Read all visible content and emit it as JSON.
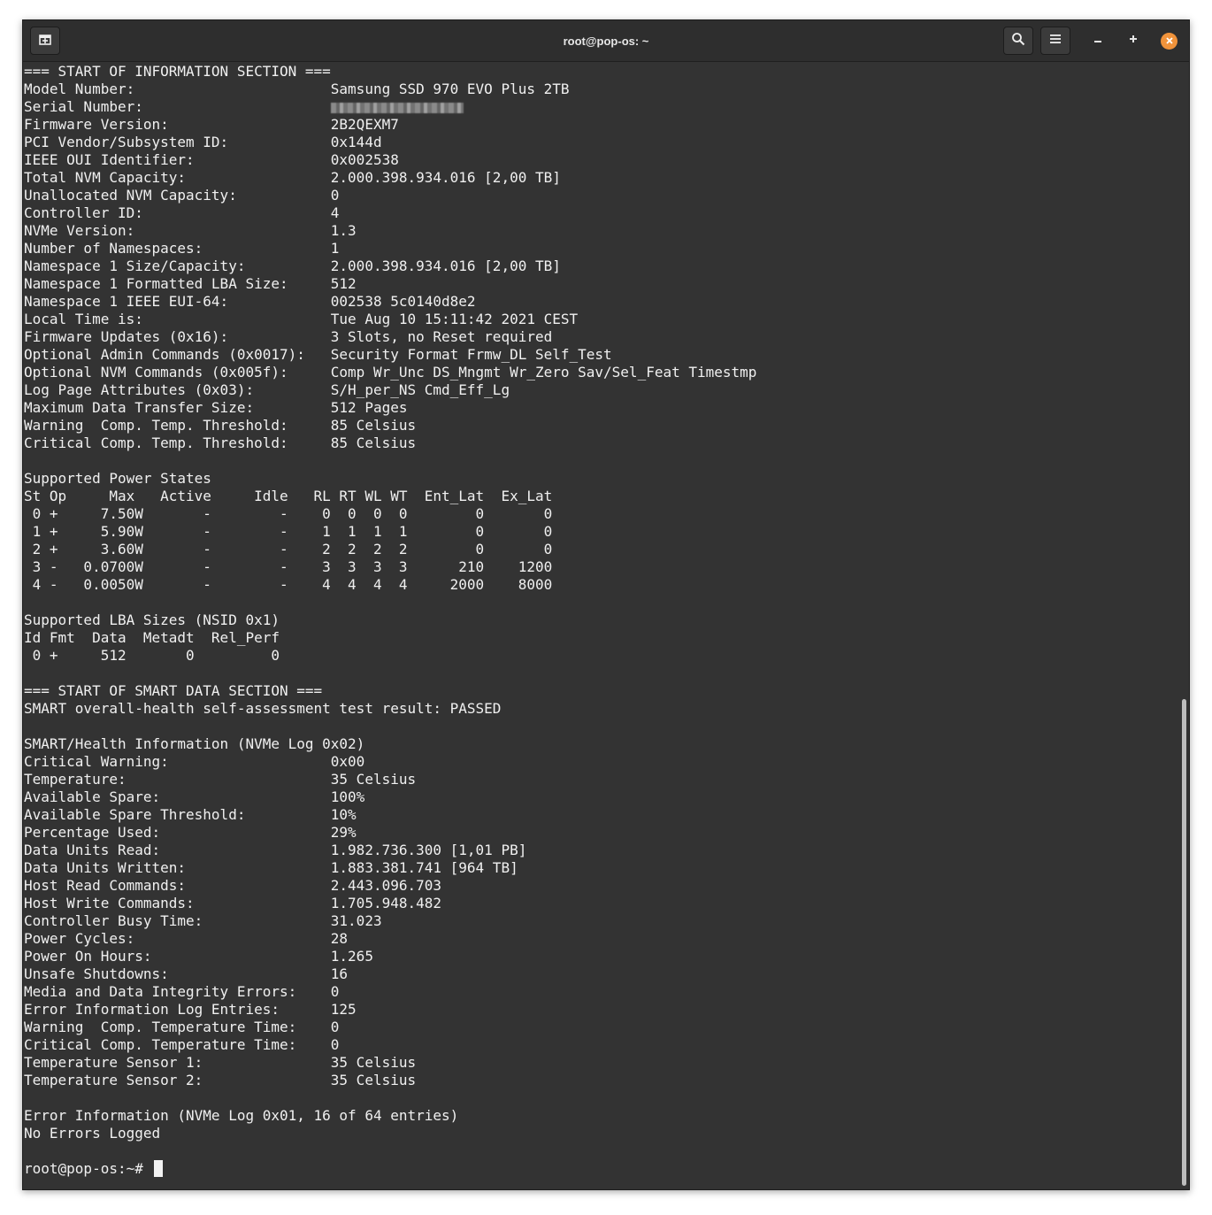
{
  "window": {
    "title": "root@pop-os: ~",
    "icons": {
      "new_tab": "new-tab-icon",
      "search": "search-icon",
      "menu": "hamburger-menu-icon",
      "minimize": "minimize-icon",
      "maximize": "maximize-icon",
      "close": "close-icon"
    },
    "accent_color": "#f0933b",
    "background_color": "#333333"
  },
  "terminal": {
    "lines": [
      "=== START OF INFORMATION SECTION ===",
      "Model Number:                       Samsung SSD 970 EVO Plus 2TB",
      "Serial Number:                      ",
      "Firmware Version:                   2B2QEXM7",
      "PCI Vendor/Subsystem ID:            0x144d",
      "IEEE OUI Identifier:                0x002538",
      "Total NVM Capacity:                 2.000.398.934.016 [2,00 TB]",
      "Unallocated NVM Capacity:           0",
      "Controller ID:                      4",
      "NVMe Version:                       1.3",
      "Number of Namespaces:               1",
      "Namespace 1 Size/Capacity:          2.000.398.934.016 [2,00 TB]",
      "Namespace 1 Formatted LBA Size:     512",
      "Namespace 1 IEEE EUI-64:            002538 5c0140d8e2",
      "Local Time is:                      Tue Aug 10 15:11:42 2021 CEST",
      "Firmware Updates (0x16):            3 Slots, no Reset required",
      "Optional Admin Commands (0x0017):   Security Format Frmw_DL Self_Test",
      "Optional NVM Commands (0x005f):     Comp Wr_Unc DS_Mngmt Wr_Zero Sav/Sel_Feat Timestmp",
      "Log Page Attributes (0x03):         S/H_per_NS Cmd_Eff_Lg",
      "Maximum Data Transfer Size:         512 Pages",
      "Warning  Comp. Temp. Threshold:     85 Celsius",
      "Critical Comp. Temp. Threshold:     85 Celsius",
      "",
      "Supported Power States",
      "St Op     Max   Active     Idle   RL RT WL WT  Ent_Lat  Ex_Lat",
      " 0 +     7.50W       -        -    0  0  0  0        0       0",
      " 1 +     5.90W       -        -    1  1  1  1        0       0",
      " 2 +     3.60W       -        -    2  2  2  2        0       0",
      " 3 -   0.0700W       -        -    3  3  3  3      210    1200",
      " 4 -   0.0050W       -        -    4  4  4  4     2000    8000",
      "",
      "Supported LBA Sizes (NSID 0x1)",
      "Id Fmt  Data  Metadt  Rel_Perf",
      " 0 +     512       0         0",
      "",
      "=== START OF SMART DATA SECTION ===",
      "SMART overall-health self-assessment test result: PASSED",
      "",
      "SMART/Health Information (NVMe Log 0x02)",
      "Critical Warning:                   0x00",
      "Temperature:                        35 Celsius",
      "Available Spare:                    100%",
      "Available Spare Threshold:          10%",
      "Percentage Used:                    29%",
      "Data Units Read:                    1.982.736.300 [1,01 PB]",
      "Data Units Written:                 1.883.381.741 [964 TB]",
      "Host Read Commands:                 2.443.096.703",
      "Host Write Commands:                1.705.948.482",
      "Controller Busy Time:               31.023",
      "Power Cycles:                       28",
      "Power On Hours:                     1.265",
      "Unsafe Shutdowns:                   16",
      "Media and Data Integrity Errors:    0",
      "Error Information Log Entries:      125",
      "Warning  Comp. Temperature Time:    0",
      "Critical Comp. Temperature Time:    0",
      "Temperature Sensor 1:               35 Celsius",
      "Temperature Sensor 2:               35 Celsius",
      "",
      "Error Information (NVMe Log 0x01, 16 of 64 entries)",
      "No Errors Logged",
      ""
    ],
    "prompt": "root@pop-os:~# "
  }
}
